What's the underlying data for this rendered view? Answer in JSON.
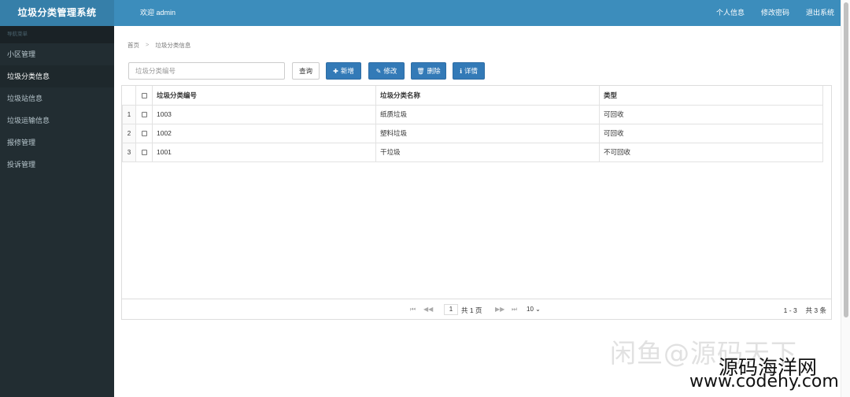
{
  "header": {
    "brand": "垃圾分类管理系统",
    "welcome": "欢迎 admin",
    "nav": [
      "个人信息",
      "修改密码",
      "退出系统"
    ]
  },
  "sidebar": {
    "header": "导航菜单",
    "items": [
      "小区管理",
      "垃圾分类信息",
      "垃圾站信息",
      "垃圾运输信息",
      "报修管理",
      "投诉管理"
    ],
    "active": "垃圾分类信息"
  },
  "breadcrumb": [
    "首页",
    "垃圾分类信息"
  ],
  "toolbar": {
    "search_placeholder": "垃圾分类编号",
    "search_value": "",
    "query": "查询",
    "add": "新增",
    "edit": "修改",
    "delete": "删除",
    "detail": "详情"
  },
  "table": {
    "columns": [
      "垃圾分类编号",
      "垃圾分类名称",
      "类型"
    ],
    "rows": [
      {
        "num": "1",
        "code": "1003",
        "name": "纸质垃圾",
        "type": "可回收"
      },
      {
        "num": "2",
        "code": "1002",
        "name": "塑料垃圾",
        "type": "可回收"
      },
      {
        "num": "3",
        "code": "1001",
        "name": "干垃圾",
        "type": "不可回收"
      }
    ]
  },
  "pager": {
    "page": "1",
    "total_pages": "共 1 页",
    "page_size": "10",
    "summary": "1 - 3 　共 3 条"
  },
  "watermark": {
    "line1": "闲鱼@源码天下",
    "line2": "源码海洋网",
    "line3": "www.codehy.com"
  },
  "colors": {
    "header": "#3c8dbc",
    "sidebar": "#222d32",
    "primary": "#337ab7"
  }
}
